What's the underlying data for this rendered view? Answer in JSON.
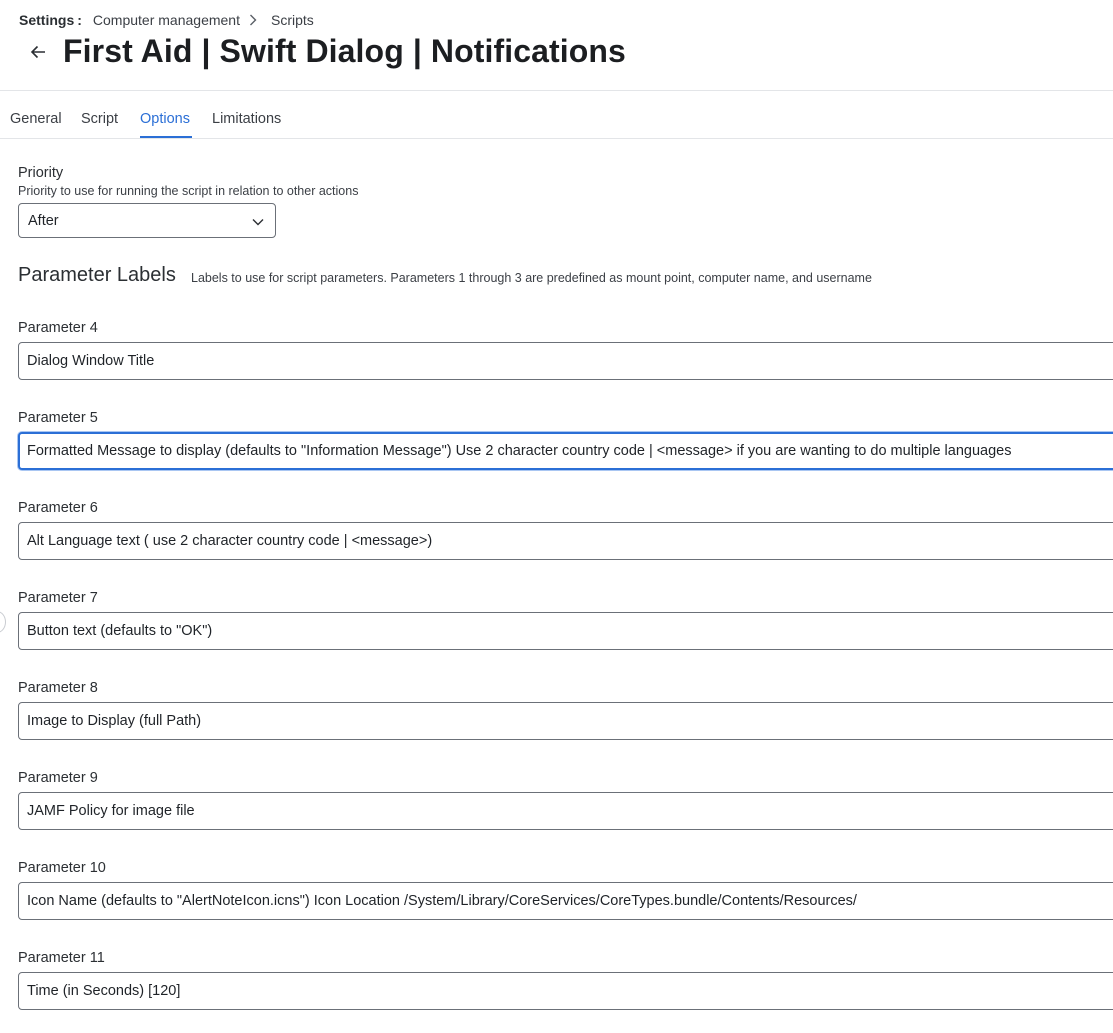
{
  "breadcrumb": {
    "root": "Settings",
    "colon": ":",
    "items": [
      "Computer management",
      "Scripts"
    ]
  },
  "page": {
    "title": "First Aid | Swift Dialog | Notifications"
  },
  "tabs": [
    {
      "label": "General",
      "active": false
    },
    {
      "label": "Script",
      "active": false
    },
    {
      "label": "Options",
      "active": true
    },
    {
      "label": "Limitations",
      "active": false
    }
  ],
  "priority": {
    "label": "Priority",
    "help": "Priority to use for running the script in relation to other actions",
    "value": "After"
  },
  "parameter_labels": {
    "title": "Parameter Labels",
    "description": "Labels to use for script parameters. Parameters 1 through 3 are predefined as mount point, computer name, and username",
    "params": [
      {
        "label": "Parameter 4",
        "value": "Dialog Window Title"
      },
      {
        "label": "Parameter 5",
        "value": "Formatted Message to display (defaults to \"Information Message\") Use 2 character country code | <message> if you are wanting to do multiple languages"
      },
      {
        "label": "Parameter 6",
        "value": "Alt Language text ( use 2 character country code | <message>)"
      },
      {
        "label": "Parameter 7",
        "value": "Button text (defaults to \"OK\")"
      },
      {
        "label": "Parameter 8",
        "value": "Image to Display (full Path)"
      },
      {
        "label": "Parameter 9",
        "value": "JAMF Policy for image file"
      },
      {
        "label": "Parameter 10",
        "value": "Icon Name (defaults to \"AlertNoteIcon.icns\") Icon Location /System/Library/CoreServices/CoreTypes.bundle/Contents/Resources/"
      },
      {
        "label": "Parameter 11",
        "value": "Time (in Seconds) [120]"
      }
    ]
  },
  "colors": {
    "accent": "#2b6fd6",
    "border": "#6b7078",
    "text": "#1f2328"
  },
  "icons": {
    "back": "arrow-left-icon",
    "breadcrumb_separator": "chevron-right-icon",
    "select": "chevron-down-icon"
  }
}
